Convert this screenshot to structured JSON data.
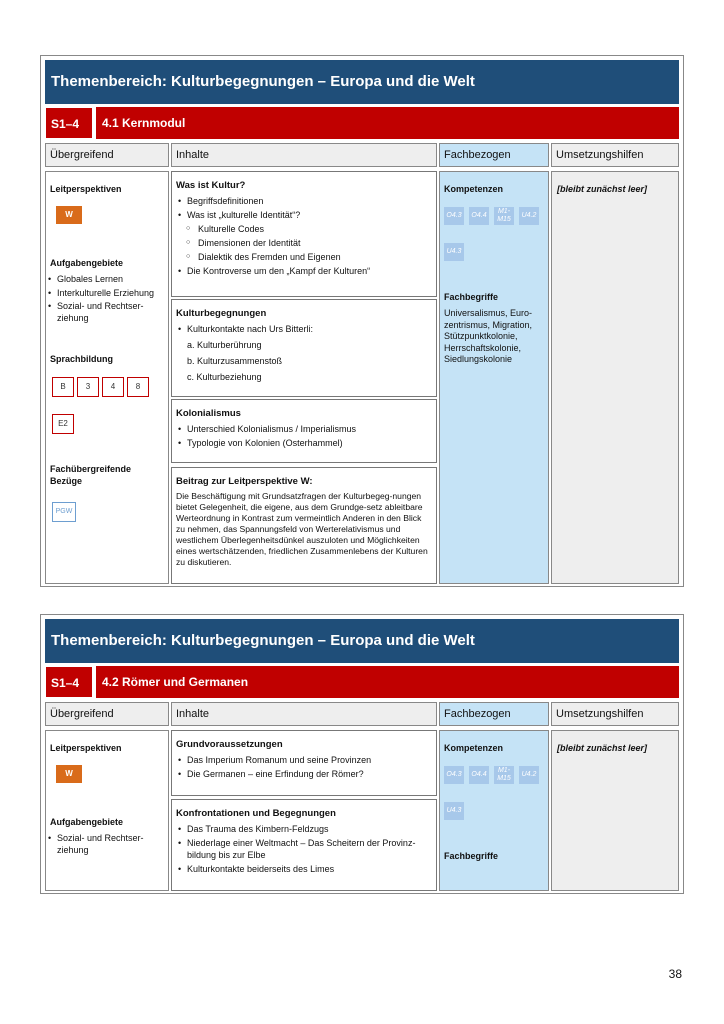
{
  "sections": [
    {
      "title": "Themenbereich: Kulturbegegnungen – Europa und die Welt",
      "code": "S1–4",
      "module": "4.1 Kernmodul",
      "headers": {
        "ueber": "Übergreifend",
        "inhalte": "Inhalte",
        "fach": "Fachbezogen",
        "umsetz": "Umsetzungshilfen"
      },
      "ueber": {
        "leit_title": "Leitperspektiven",
        "leit_tag": "W",
        "aufg_title": "Aufgabengebiete",
        "aufg_items": [
          "Globales Lernen",
          "Interkulturelle Erziehung",
          "Sozial- und Rechtser-ziehung"
        ],
        "sprach_title": "Sprachbildung",
        "sprach_tags": [
          "B",
          "3",
          "4",
          "8",
          "E2"
        ],
        "fach_title": "Fachübergreifende Bezüge",
        "fach_tag": "PGW"
      },
      "inhalte": {
        "box1": {
          "title": "Was ist Kultur?",
          "b1": "Begriffsdefinitionen",
          "b2": "Was ist „kulturelle Identität“?",
          "o1": "Kulturelle Codes",
          "o2": "Dimensionen der Identität",
          "o3": "Dialektik des Fremden und Eigenen",
          "b3": "Die Kontroverse um den „Kampf der Kulturen“"
        },
        "box2": {
          "title": "Kulturbegegnungen",
          "b1": "Kulturkontakte nach Urs Bitterli:",
          "n1": "a. Kulturberührung",
          "n2": "b. Kulturzusammenstoß",
          "n3": "c. Kulturbeziehung"
        },
        "box3": {
          "title": "Kolonialismus",
          "b1": "Unterschied Kolonialismus / Imperialismus",
          "b2": "Typologie von Kolonien (Osterhammel)"
        },
        "box4": {
          "title": "Beitrag zur Leitperspektive W:",
          "text": "Die Beschäftigung mit Grundsatzfragen der Kulturbegeg-nungen bietet Gelegenheit, die eigene, aus dem Grundge-setz ableitbare Werteordnung in Kontrast zum vermeintlich Anderen in den Blick zu nehmen, das Spannungsfeld von Werterelativismus und westlichem Überlegenheitsdünkel auszuloten und Möglichkeiten eines wertschätzenden, friedlichen Zusammenlebens der Kulturen zu diskutieren."
        }
      },
      "fach": {
        "komp_title": "Kompetenzen",
        "komp_tags": [
          "O4.3",
          "O4.4",
          "M1-M15",
          "U4.2",
          "U4.3"
        ],
        "begriffe_title": "Fachbegriffe",
        "begriffe": "Universalismus, Euro-zentrismus, Migration, Stützpunktkolonie, Herrschaftskolonie, Siedlungskolonie"
      },
      "umsetz": "[bleibt zunächst leer]"
    },
    {
      "title": "Themenbereich: Kulturbegegnungen – Europa und die Welt",
      "code": "S1–4",
      "module": "4.2 Römer und Germanen",
      "headers": {
        "ueber": "Übergreifend",
        "inhalte": "Inhalte",
        "fach": "Fachbezogen",
        "umsetz": "Umsetzungshilfen"
      },
      "ueber": {
        "leit_title": "Leitperspektiven",
        "leit_tag": "W",
        "aufg_title": "Aufgabengebiete",
        "aufg_items": [
          "Sozial- und Rechtser-ziehung"
        ]
      },
      "inhalte": {
        "box1": {
          "title": "Grundvoraussetzungen",
          "b1": "Das Imperium Romanum und seine Provinzen",
          "b2": "Die Germanen – eine Erfindung der Römer?"
        },
        "box2": {
          "title": "Konfrontationen und Begegnungen",
          "b1": "Das Trauma des Kimbern-Feldzugs",
          "b2": "Niederlage einer Weltmacht – Das Scheitern der Provinz-bildung bis zur Elbe",
          "b3": "Kulturkontakte beiderseits des Limes"
        }
      },
      "fach": {
        "komp_title": "Kompetenzen",
        "komp_tags": [
          "O4.3",
          "O4.4",
          "M1-M15",
          "U4.2",
          "U4.3"
        ],
        "begriffe_title": "Fachbegriffe"
      },
      "umsetz": "[bleibt zunächst leer]"
    }
  ],
  "page_number": "38"
}
